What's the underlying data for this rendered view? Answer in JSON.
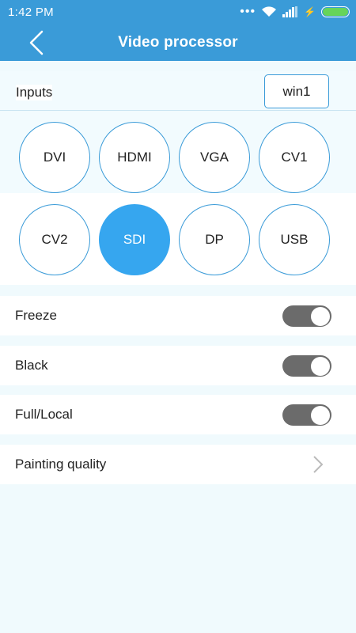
{
  "status_bar": {
    "time": "1:42 PM"
  },
  "header": {
    "title": "Video processor"
  },
  "inputs": {
    "label": "Inputs",
    "window_value": "win1"
  },
  "sources": {
    "row1": [
      "DVI",
      "HDMI",
      "VGA",
      "CV1"
    ],
    "row2": [
      "CV2",
      "SDI",
      "DP",
      "USB"
    ],
    "selected": "SDI"
  },
  "settings": {
    "freeze": {
      "label": "Freeze",
      "on": true
    },
    "black": {
      "label": "Black",
      "on": true
    },
    "full_local": {
      "label": "Full/Local",
      "on": true
    },
    "painting_quality": {
      "label": "Painting quality"
    }
  },
  "colors": {
    "accent": "#3a9bd8",
    "selected": "#36a6ef",
    "toggle": "#6b6b6b",
    "battery": "#66d45a"
  }
}
